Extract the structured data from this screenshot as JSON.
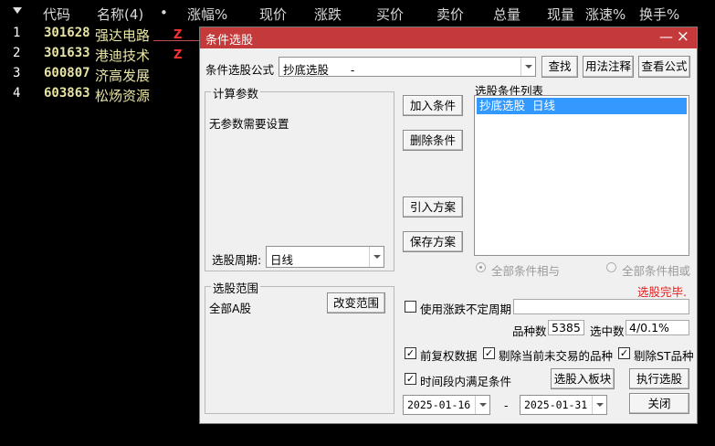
{
  "table": {
    "headers": [
      "代码",
      "名称(4)",
      "•",
      "涨幅%",
      "现价",
      "涨跌",
      "买价",
      "卖价",
      "总量",
      "现量",
      "涨速%",
      "换手%"
    ],
    "rows": [
      {
        "index": "1",
        "code": "301628",
        "name": "强达电路",
        "flag": "Z"
      },
      {
        "index": "2",
        "code": "301633",
        "name": "港迪技术",
        "flag": "Z"
      },
      {
        "index": "3",
        "code": "600807",
        "name": "济高发展",
        "flag": ""
      },
      {
        "index": "4",
        "code": "603863",
        "name": "松炀资源",
        "flag": ""
      }
    ]
  },
  "dialog": {
    "title": "条件选股",
    "formula_label": "条件选股公式",
    "formula_value": "抄底选股      -",
    "find_button": "查找",
    "usage_button": "用法注释",
    "view_formula_button": "查看公式",
    "calc_params": {
      "title": "计算参数",
      "text": "无参数需要设置",
      "period_label": "选股周期:",
      "period_value": "日线"
    },
    "add_condition": "加入条件",
    "delete_condition": "删除条件",
    "import_plan": "引入方案",
    "save_plan": "保存方案",
    "conditions_list": {
      "title": "选股条件列表",
      "items": [
        "抄底选股  日线"
      ]
    },
    "radio_and": "全部条件相与",
    "radio_or": "全部条件相或",
    "status": "选股完毕.",
    "scope": {
      "title": "选股范围",
      "value": "全部A股",
      "change_button": "改变范围"
    },
    "use_uncertain_period": "使用涨跌不定周期",
    "variety_count_label": "品种数",
    "variety_count": "5385",
    "selected_count_label": "选中数",
    "selected_count": "4/0.1%",
    "forward_adjust": "前复权数据",
    "exclude_not_trading": "剔除当前未交易的品种",
    "exclude_st": "剔除ST品种",
    "period_satisfy": "时间段内满足条件",
    "select_to_block": "选股入板块",
    "execute": "执行选股",
    "date_from": "2025-01-16",
    "date_sep": "-",
    "date_to": "2025-01-31",
    "close": "关闭"
  },
  "colors": {
    "title_bar": "#c43a3a",
    "selection": "#3399ff",
    "status_red": "#e02020",
    "stock_text": "#e8e4a4"
  }
}
